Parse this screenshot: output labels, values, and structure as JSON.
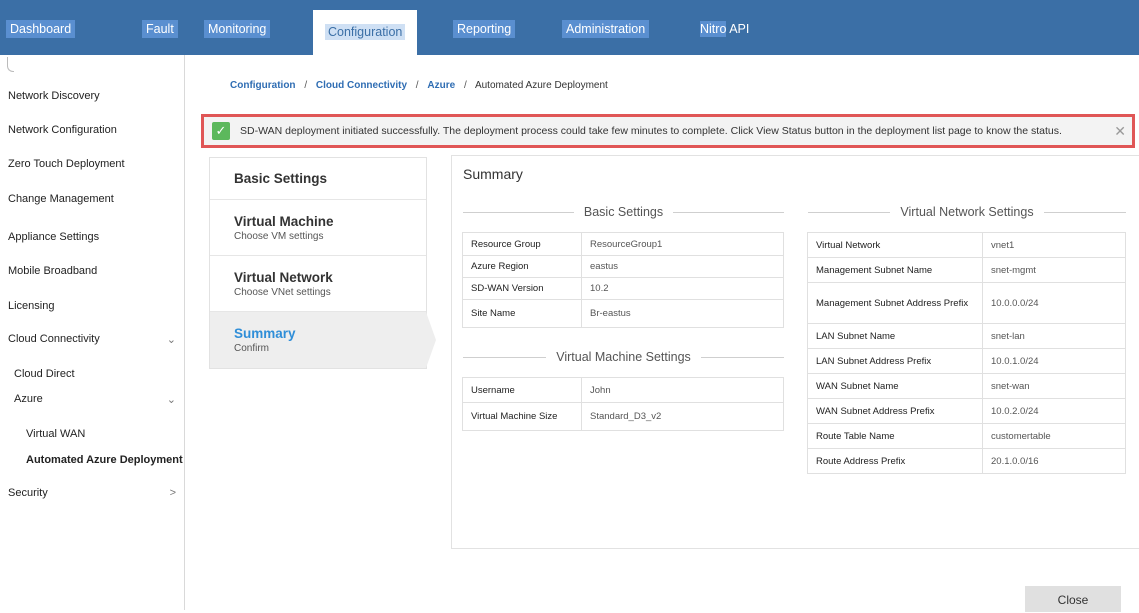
{
  "nav": {
    "items": [
      "Dashboard",
      "Fault",
      "Monitoring",
      "Configuration",
      "Reporting",
      "Administration",
      "Nitro",
      "API"
    ]
  },
  "sidebar": {
    "items": [
      {
        "label": "Network Discovery"
      },
      {
        "label": "Network Configuration"
      },
      {
        "label": "Zero Touch Deployment"
      },
      {
        "label": "Change Management"
      },
      {
        "label": "Appliance Settings"
      },
      {
        "label": "Mobile Broadband"
      },
      {
        "label": "Licensing"
      },
      {
        "label": "Cloud Connectivity",
        "chevron": "chevron-down-icon"
      },
      {
        "label": "Cloud Direct"
      },
      {
        "label": "Azure",
        "chevron": "chevron-down-icon"
      },
      {
        "label": "Virtual WAN"
      },
      {
        "label": "Automated Azure Deployment"
      },
      {
        "label": "Security",
        "chevron": "chevron-right-icon"
      }
    ]
  },
  "breadcrumb": {
    "items": [
      "Configuration",
      "Cloud Connectivity",
      "Azure"
    ],
    "separator": "/",
    "current": "Automated Azure Deployment"
  },
  "notice": {
    "message": "SD-WAN deployment initiated successfully. The deployment process could take few minutes to complete. Click View Status button in the deployment list page to know the status.",
    "icon": "check-icon",
    "close_icon": "close-icon",
    "close_glyph": "✕",
    "check_glyph": "✓",
    "color": "#5cb85c",
    "border_color": "#e05656"
  },
  "steps": [
    {
      "title": "Basic Settings",
      "subtitle": ""
    },
    {
      "title": "Virtual Machine",
      "subtitle": "Choose VM settings"
    },
    {
      "title": "Virtual Network",
      "subtitle": "Choose VNet settings"
    },
    {
      "title": "Summary",
      "subtitle": "Confirm"
    }
  ],
  "summary": {
    "title": "Summary",
    "basic_settings": {
      "heading": "Basic Settings",
      "rows": [
        [
          "Resource Group",
          "ResourceGroup1"
        ],
        [
          "Azure Region",
          "eastus"
        ],
        [
          "SD-WAN Version",
          "10.2"
        ],
        [
          "Site Name",
          "Br-eastus"
        ]
      ]
    },
    "vm_settings": {
      "heading": "Virtual Machine Settings",
      "rows": [
        [
          "Username",
          "John"
        ],
        [
          "Virtual Machine Size",
          "Standard_D3_v2"
        ]
      ]
    },
    "vnet_settings": {
      "heading": "Virtual Network Settings",
      "rows": [
        [
          "Virtual Network",
          "vnet1"
        ],
        [
          "Management Subnet Name",
          "snet-mgmt"
        ],
        [
          "Management Subnet Address Prefix",
          "10.0.0.0/24"
        ],
        [
          "LAN Subnet Name",
          "snet-lan"
        ],
        [
          "LAN Subnet Address Prefix",
          "10.0.1.0/24"
        ],
        [
          "WAN Subnet Name",
          "snet-wan"
        ],
        [
          "WAN Subnet Address Prefix",
          "10.0.2.0/24"
        ],
        [
          "Route Table Name",
          "customertable"
        ],
        [
          "Route Address Prefix",
          "20.1.0.0/16"
        ]
      ]
    }
  },
  "footer": {
    "close_label": "Close"
  },
  "colors": {
    "nav_bg": "#3b6fa6",
    "accent": "#2f8ed8",
    "link": "#2f6db3"
  }
}
